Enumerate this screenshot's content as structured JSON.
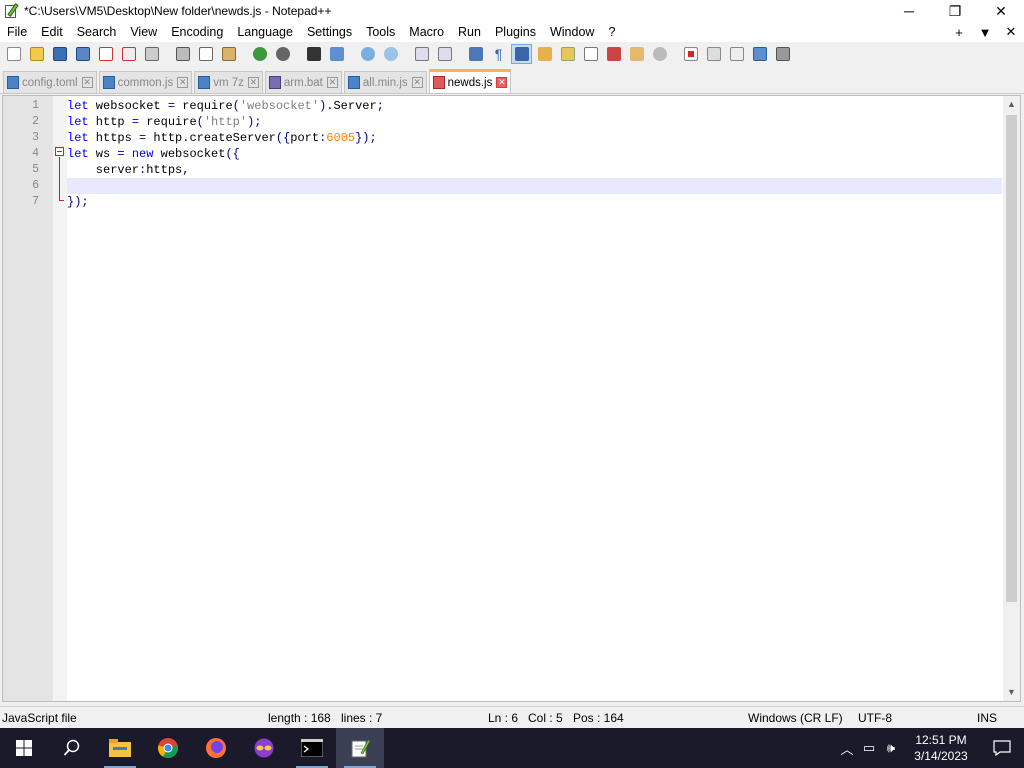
{
  "window": {
    "title": "*C:\\Users\\VM5\\Desktop\\New folder\\newds.js - Notepad++",
    "minimize": "─",
    "restore": "❐",
    "close": "✕"
  },
  "menu": {
    "items": [
      "File",
      "Edit",
      "Search",
      "View",
      "Encoding",
      "Language",
      "Settings",
      "Tools",
      "Macro",
      "Run",
      "Plugins",
      "Window",
      "?"
    ],
    "right": [
      "+",
      "▼",
      "✕"
    ]
  },
  "tabs": [
    {
      "label": "config.toml",
      "active": false
    },
    {
      "label": "common.js",
      "active": false
    },
    {
      "label": "vm 7z",
      "active": false
    },
    {
      "label": "arm.bat",
      "active": false
    },
    {
      "label": "all.min.js",
      "active": false
    },
    {
      "label": "newds.js",
      "active": true
    }
  ],
  "editor": {
    "line_numbers": [
      "1",
      "2",
      "3",
      "4",
      "5",
      "6",
      "7"
    ],
    "current_line": 6
  },
  "statusbar": {
    "filetype": "JavaScript file",
    "length": "length : 168",
    "lines": "lines : 7",
    "ln": "Ln : 6",
    "col": "Col : 5",
    "pos": "Pos : 164",
    "eol": "Windows (CR LF)",
    "encoding": "UTF-8",
    "mode": "INS"
  },
  "taskbar": {
    "time": "12:51 PM",
    "date": "3/14/2023"
  },
  "colors": {
    "keyword": "#0000ff",
    "string": "#808080",
    "number": "#ff8000",
    "operator": "#000080",
    "current_line": "#e8e8ff",
    "active_tab_accent": "#fab44a"
  }
}
